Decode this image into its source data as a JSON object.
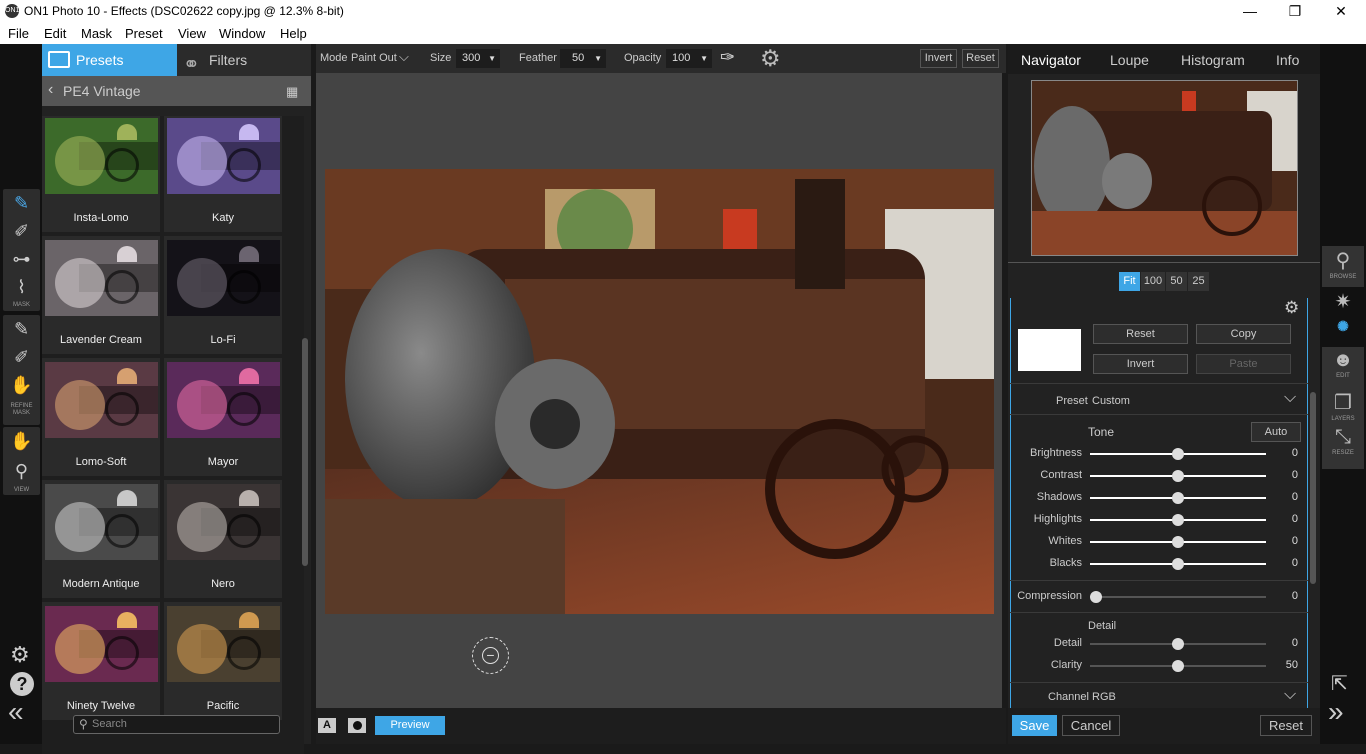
{
  "window": {
    "title": "ON1 Photo 10 - Effects (DSC02622 copy.jpg @ 12.3% 8-bit)",
    "app_icon": "on1-logo-icon",
    "minimize": "—",
    "restore": "❐",
    "close": "✕"
  },
  "menu": [
    "File",
    "Edit",
    "Mask",
    "Preset",
    "View",
    "Window",
    "Help"
  ],
  "left_tools": {
    "mask_label": "MASK",
    "refine_label": "REFINE\nMASK",
    "view_label": "VIEW"
  },
  "presets_panel": {
    "tab_presets": "Presets",
    "tab_filters": "Filters",
    "category": "PE4 Vintage",
    "search_placeholder": "Search",
    "thumbs": [
      {
        "label": "Insta-Lomo",
        "tint": "#3c6a2a",
        "accent": "#9fb25a"
      },
      {
        "label": "Katy",
        "tint": "#5a4a8a",
        "accent": "#c6b8f0"
      },
      {
        "label": "Lavender Cream",
        "tint": "#6a6468",
        "accent": "#d8d0d4"
      },
      {
        "label": "Lo-Fi",
        "tint": "#141218",
        "accent": "#6b6470"
      },
      {
        "label": "Lomo-Soft",
        "tint": "#5a3a44",
        "accent": "#d6a070"
      },
      {
        "label": "Mayor",
        "tint": "#5a2a5a",
        "accent": "#e06aa0"
      },
      {
        "label": "Modern Antique",
        "tint": "#4a4a4a",
        "accent": "#c8c8c8"
      },
      {
        "label": "Nero",
        "tint": "#3a3434",
        "accent": "#b8b0ac"
      },
      {
        "label": "Ninety Twelve",
        "tint": "#6a2a50",
        "accent": "#e8b060"
      },
      {
        "label": "Pacific",
        "tint": "#4a4030",
        "accent": "#d09a50"
      }
    ]
  },
  "topbar": {
    "mode_label": "Mode",
    "mode_value": "Paint Out",
    "size_label": "Size",
    "size_value": "300",
    "feather_label": "Feather",
    "feather_value": "50",
    "opacity_label": "Opacity",
    "opacity_value": "100",
    "invert": "Invert",
    "reset": "Reset"
  },
  "bottombar": {
    "a_label": "A",
    "preview": "Preview"
  },
  "navigator": {
    "tabs": [
      "Navigator",
      "Loupe",
      "Histogram",
      "Info"
    ],
    "zoom": [
      "Fit",
      "100",
      "50",
      "25"
    ],
    "active_zoom": "Fit"
  },
  "adjust": {
    "reset": "Reset",
    "copy": "Copy",
    "invert": "Invert",
    "paste": "Paste",
    "preset_label": "Preset",
    "preset_value": "Custom",
    "tone_title": "Tone",
    "auto": "Auto",
    "tone_sliders": [
      {
        "label": "Brightness",
        "value": "0",
        "pos": 0.5
      },
      {
        "label": "Contrast",
        "value": "0",
        "pos": 0.5
      },
      {
        "label": "Shadows",
        "value": "0",
        "pos": 0.5
      },
      {
        "label": "Highlights",
        "value": "0",
        "pos": 0.5
      },
      {
        "label": "Whites",
        "value": "0",
        "pos": 0.5
      },
      {
        "label": "Blacks",
        "value": "0",
        "pos": 0.5
      }
    ],
    "compression": {
      "label": "Compression",
      "value": "0",
      "pos": 0.0
    },
    "detail_title": "Detail",
    "detail_sliders": [
      {
        "label": "Detail",
        "value": "0",
        "pos": 0.5
      },
      {
        "label": "Clarity",
        "value": "50",
        "pos": 0.5
      }
    ],
    "channel_label": "Channel",
    "channel_value": "RGB",
    "save": "Save",
    "cancel": "Cancel",
    "reset_all": "Reset"
  },
  "right_tools": {
    "browse": "BROWSE",
    "edit": "EDIT",
    "layers": "LAYERS",
    "resize": "RESIZE"
  },
  "colors": {
    "accent": "#3ea6e6",
    "panel": "#222222"
  }
}
